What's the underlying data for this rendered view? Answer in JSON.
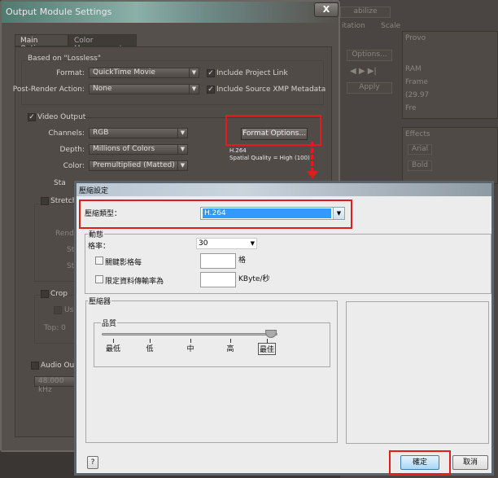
{
  "background_app": {
    "right_items": [
      "abilize",
      "itation",
      "Scale",
      "Options...",
      "Apply",
      "Provo",
      "RAM",
      "Frame",
      "(29.97",
      "Fre",
      "Effects",
      "Arial",
      "Bold"
    ]
  },
  "output_module": {
    "title": "Output Module Settings",
    "close_label": "X",
    "tabs": [
      {
        "label": "Main Options",
        "active": true
      },
      {
        "label": "Color Management",
        "active": false
      }
    ],
    "based_on": "Based on \"Lossless\"",
    "format_label": "Format:",
    "format_value": "QuickTime Movie",
    "post_render_label": "Post-Render Action:",
    "post_render_value": "None",
    "include_project_link": "Include Project Link",
    "include_xmp": "Include Source XMP Metadata",
    "video_output": "Video Output",
    "channels_label": "Channels:",
    "channels_value": "RGB",
    "depth_label": "Depth:",
    "depth_value": "Millions of Colors",
    "color_label": "Color:",
    "color_value": "Premultiplied (Matted)",
    "format_options_label": "Format Options...",
    "codec_info": "H.264",
    "quality_info": "Spatial Quality = High (100)",
    "start_partial": "Sta",
    "stretch": "Stretch",
    "render_partial": "Rende",
    "st1": "St",
    "st2": "St",
    "crop": "Crop",
    "use_partial": "Us",
    "top_partial": "Top: 0",
    "audio_output": "Audio Out",
    "audio_rate": "48.000 kHz"
  },
  "compression_dialog": {
    "title": "壓縮設定",
    "type_label": "壓縮類型：",
    "type_value": "H.264",
    "motion_group": "動態",
    "frame_rate_label": "格率：",
    "frame_rate_value": "30",
    "keyframe_label": "關鍵影格每",
    "keyframe_value": "",
    "keyframe_unit": "格",
    "limit_label": "限定資料傳輸率為",
    "limit_value": "",
    "limit_unit": "KByte/秒",
    "compressor_group": "壓縮器",
    "quality_group": "品質",
    "quality_ticks": [
      "最低",
      "低",
      "中",
      "高",
      "最佳"
    ],
    "quality_level": "最佳",
    "help_label": "?",
    "ok_label": "確定",
    "cancel_label": "取消"
  },
  "colors": {
    "highlight": "#e21b1b",
    "selection": "#3399ff"
  }
}
